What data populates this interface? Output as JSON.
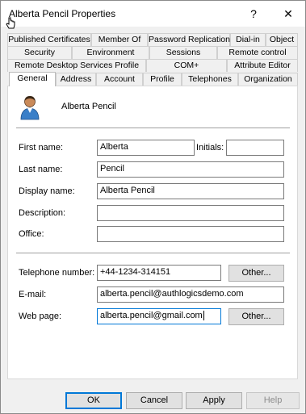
{
  "window": {
    "title": "Alberta Pencil Properties",
    "help_label": "?",
    "close_label": "✕"
  },
  "tabs": {
    "row1": [
      "Published Certificates",
      "Member Of",
      "Password Replication",
      "Dial-in",
      "Object"
    ],
    "row2": [
      "Security",
      "Environment",
      "Sessions",
      "Remote control"
    ],
    "row3": [
      "Remote Desktop Services Profile",
      "COM+",
      "Attribute Editor"
    ],
    "row4": [
      "General",
      "Address",
      "Account",
      "Profile",
      "Telephones",
      "Organization"
    ],
    "active": "General"
  },
  "general": {
    "user_icon": "user-icon",
    "display_heading": "Alberta Pencil",
    "fields": {
      "first_name": {
        "label": "First name:",
        "value": "Alberta"
      },
      "initials": {
        "label": "Initials:",
        "value": ""
      },
      "last_name": {
        "label": "Last name:",
        "value": "Pencil"
      },
      "display_name": {
        "label": "Display name:",
        "value": "Alberta Pencil"
      },
      "description": {
        "label": "Description:",
        "value": ""
      },
      "office": {
        "label": "Office:",
        "value": ""
      },
      "telephone": {
        "label": "Telephone number:",
        "value": "+44-1234-314151"
      },
      "email": {
        "label": "E-mail:",
        "value": "alberta.pencil@authlogicsdemo.com"
      },
      "web_page": {
        "label": "Web page:",
        "value": "alberta.pencil@gmail.com"
      }
    },
    "other_label": "Other..."
  },
  "buttons": {
    "ok": "OK",
    "cancel": "Cancel",
    "apply": "Apply",
    "help": "Help"
  },
  "colors": {
    "accent": "#0078d7",
    "window_bg": "#f0f0f0",
    "panel_bg": "#ffffff"
  }
}
